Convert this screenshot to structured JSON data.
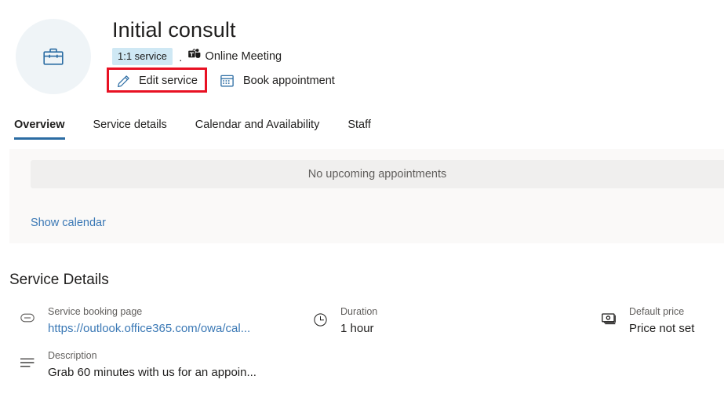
{
  "header": {
    "avatar_icon": "briefcase-icon",
    "title": "Initial consult",
    "badge": "1:1 service",
    "separator": "·",
    "meeting_type_icon": "microsoft-teams-icon",
    "meeting_type": "Online Meeting",
    "actions": [
      {
        "icon": "pencil-icon",
        "label": "Edit service"
      },
      {
        "icon": "calendar-icon",
        "label": "Book appointment"
      }
    ],
    "annotation_color": "#e81123"
  },
  "tabs": [
    {
      "label": "Overview",
      "active": true
    },
    {
      "label": "Service details",
      "active": false
    },
    {
      "label": "Calendar and Availability",
      "active": false
    },
    {
      "label": "Staff",
      "active": false
    }
  ],
  "overview": {
    "empty_state": "No upcoming appointments",
    "show_calendar_link": "Show calendar"
  },
  "service_details": {
    "heading": "Service Details",
    "items": [
      {
        "icon": "link-icon",
        "label": "Service booking page",
        "value": "https://outlook.office365.com/owa/cal...",
        "is_link": true
      },
      {
        "icon": "clock-icon",
        "label": "Duration",
        "value": "1 hour",
        "is_link": false
      },
      {
        "icon": "money-icon",
        "label": "Default price",
        "value": "Price not set",
        "is_link": false
      },
      {
        "icon": "description-lines-icon",
        "label": "Description",
        "value": "Grab 60 minutes with us for an appoin...",
        "is_link": false
      }
    ]
  },
  "colors": {
    "accent": "#2b6ca3",
    "link": "#3a78b5",
    "badge_bg": "#cfe8f4",
    "panel_bg": "#faf9f8",
    "empty_bar_bg": "#f0efee",
    "annotation": "#e81123"
  }
}
